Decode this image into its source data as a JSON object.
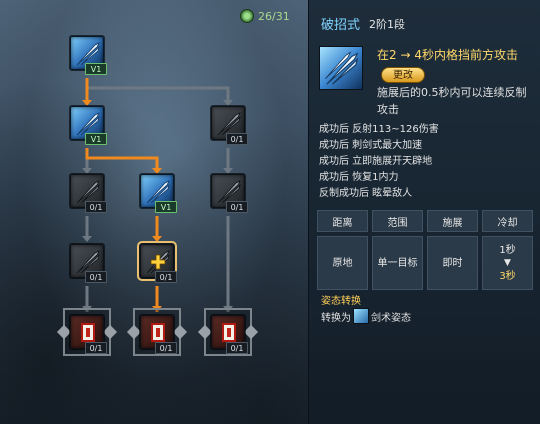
{
  "tree": {
    "points_used": "26/31",
    "nodes": [
      {
        "id": "r1c1",
        "state": "active",
        "level": "V1"
      },
      {
        "id": "r2c1",
        "state": "active",
        "level": "V1"
      },
      {
        "id": "r2c3",
        "state": "inactive",
        "level": "0/1"
      },
      {
        "id": "r3c1",
        "state": "inactive",
        "level": "0/1"
      },
      {
        "id": "r3c2",
        "state": "active",
        "level": "V1"
      },
      {
        "id": "r3c3",
        "state": "inactive",
        "level": "0/1"
      },
      {
        "id": "r4c1",
        "state": "inactive",
        "level": "0/1"
      },
      {
        "id": "r4c2",
        "state": "selected",
        "level": "0/1"
      },
      {
        "id": "r5c1",
        "state": "locked",
        "level": "0/1"
      },
      {
        "id": "r5c2",
        "state": "locked",
        "level": "0/1"
      },
      {
        "id": "r5c3",
        "state": "locked",
        "level": "0/1"
      }
    ]
  },
  "info": {
    "skill_name": "破招式",
    "skill_level": "2阶1段",
    "effect_title": "在2 → 4秒内格挡前方攻击",
    "change_label": "更改",
    "effect_desc": "施展后的0.5秒内可以连续反制攻击",
    "effects": [
      "成功后 反射113~126伤害",
      "成功后 刺剑式最大加速",
      "成功后 立即施展开天辟地",
      "成功后 恢复1内力",
      "反制成功后 眩晕敌人"
    ],
    "table": {
      "headers": [
        "距离",
        "范围",
        "施展",
        "冷却"
      ],
      "values": [
        "原地",
        "单一目标",
        "即时"
      ],
      "cooldown_from": "1秒",
      "cooldown_arrow": "▼",
      "cooldown_to": "3秒"
    },
    "stance_title": "姿态转换",
    "stance_prefix": "转换为",
    "stance_name": "剑术姿态"
  },
  "colors": {
    "highlight_line": "#f08a1e",
    "inactive_line": "#6e7882",
    "skill_name": "#7fd3ff",
    "effect_title": "#ffd86b",
    "stance_title": "#ffcf5a"
  },
  "icons": {
    "points": "green-swirl-icon",
    "skill": "sword-blades-icon",
    "plus": "plus-icon",
    "locked": "red-card-icon"
  }
}
